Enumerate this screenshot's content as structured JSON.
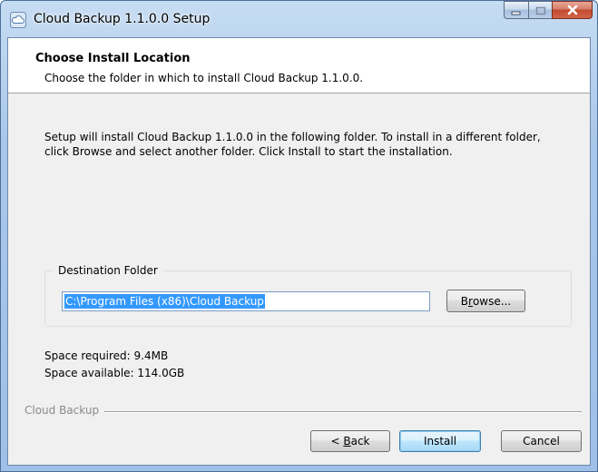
{
  "window": {
    "title": "Cloud Backup 1.1.0.0 Setup",
    "icon": "cloud-icon"
  },
  "header": {
    "title": "Choose Install Location",
    "subtitle": "Choose the folder in which to install Cloud Backup 1.1.0.0."
  },
  "intro": {
    "line1": "Setup will install Cloud Backup 1.1.0.0 in the following folder. To install in a different folder,",
    "line2": "click Browse and select another folder. Click Install to start the installation."
  },
  "destination": {
    "group_label": "Destination Folder",
    "path": "C:\\Program Files (x86)\\Cloud Backup",
    "browse_label_pre": "B",
    "browse_label_ul": "r",
    "browse_label_post": "owse..."
  },
  "space": {
    "required": "Space required: 9.4MB",
    "available": "Space available: 114.0GB"
  },
  "branding": "Cloud Backup",
  "buttons": {
    "back_pre": "< ",
    "back_ul": "B",
    "back_post": "ack",
    "install": "Install",
    "cancel": "Cancel"
  },
  "colors": {
    "selection": "#3399ff",
    "close_button": "#c24a2e"
  }
}
